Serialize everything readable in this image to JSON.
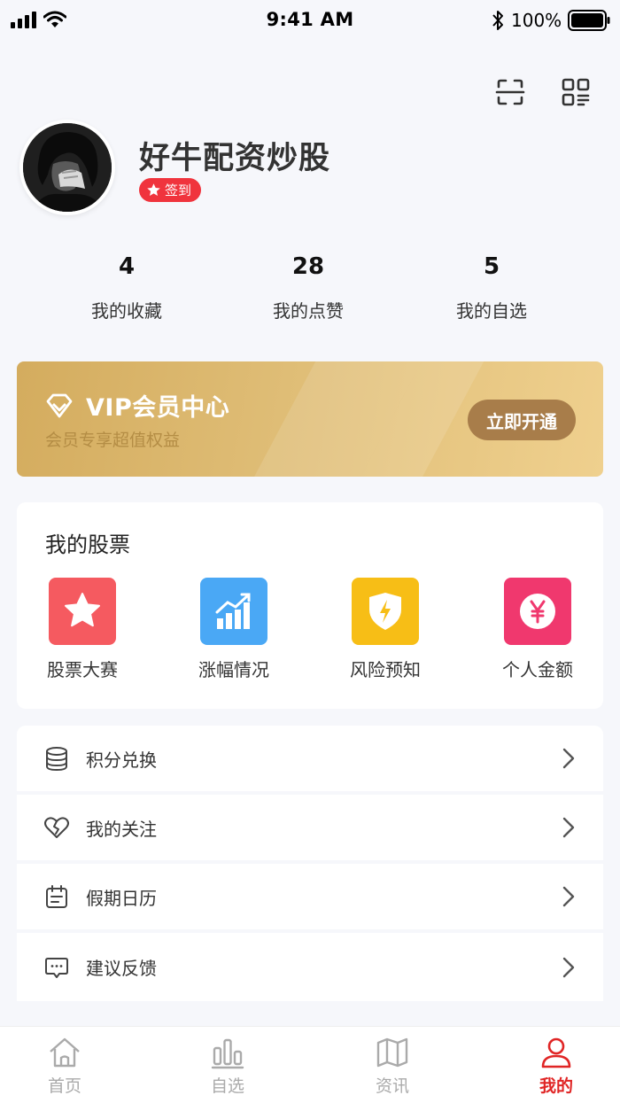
{
  "status_bar": {
    "time": "9:41 AM",
    "battery": "100%"
  },
  "profile": {
    "name": "好牛配资炒股",
    "checkin_label": "签到"
  },
  "stats": [
    {
      "value": "4",
      "label": "我的收藏"
    },
    {
      "value": "28",
      "label": "我的点赞"
    },
    {
      "value": "5",
      "label": "我的自选"
    }
  ],
  "vip": {
    "title": "VIP会员中心",
    "subtitle": "会员专享超值权益",
    "button": "立即开通"
  },
  "stocks": {
    "title": "我的股票",
    "items": [
      {
        "label": "股票大赛",
        "icon": "star-icon",
        "color": "#f55a60"
      },
      {
        "label": "涨幅情况",
        "icon": "bar-chart-icon",
        "color": "#4aa8f5"
      },
      {
        "label": "风险预知",
        "icon": "shield-bolt-icon",
        "color": "#f7be16"
      },
      {
        "label": "个人金额",
        "icon": "yen-icon",
        "color": "#f0386e"
      }
    ]
  },
  "menu": [
    {
      "label": "积分兑换",
      "icon": "coins-icon"
    },
    {
      "label": "我的关注",
      "icon": "heart-broken-icon"
    },
    {
      "label": "假期日历",
      "icon": "calendar-icon"
    },
    {
      "label": "建议反馈",
      "icon": "chat-icon"
    }
  ],
  "tabs": [
    {
      "label": "首页",
      "icon": "home-icon"
    },
    {
      "label": "自选",
      "icon": "bars-icon"
    },
    {
      "label": "资讯",
      "icon": "map-icon"
    },
    {
      "label": "我的",
      "icon": "person-icon",
      "active": true
    }
  ],
  "colors": {
    "accent": "#e02525",
    "vip_gold": "#d4ac5e",
    "vip_button": "#a87d4a",
    "checkin": "#f0343d"
  }
}
